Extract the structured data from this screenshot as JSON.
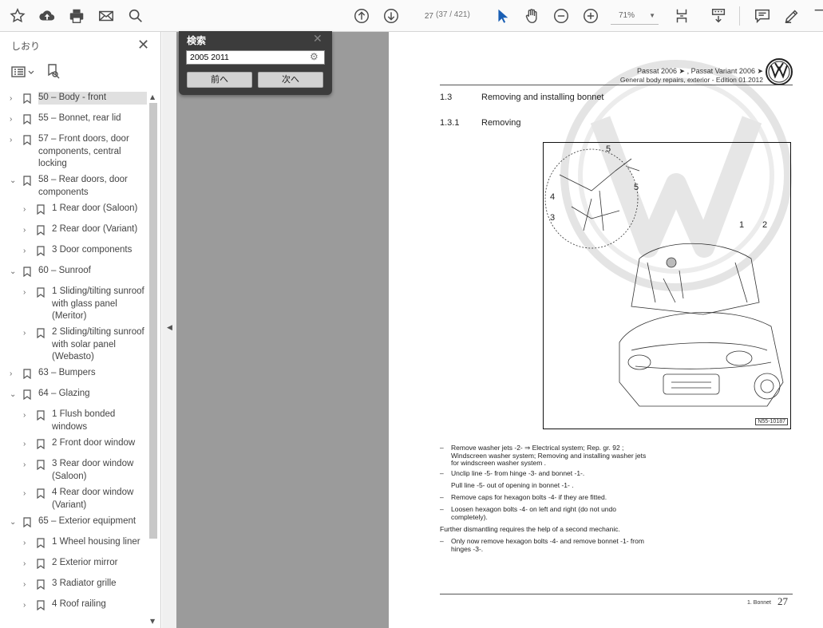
{
  "toolbar": {
    "page_current": "27",
    "page_count": "(37 / 421)",
    "zoom": "71%"
  },
  "sidebar": {
    "title": "しおり",
    "items": [
      {
        "label": "50 – Body - front",
        "level": 0,
        "chev": "›",
        "selected": true
      },
      {
        "label": "55 – Bonnet, rear lid",
        "level": 0,
        "chev": "›"
      },
      {
        "label": "57 – Front doors, door components, central locking",
        "level": 0,
        "chev": "›"
      },
      {
        "label": "58 – Rear doors, door components",
        "level": 0,
        "chev": "⌄"
      },
      {
        "label": "1 Rear door (Saloon)",
        "level": 1,
        "chev": "›"
      },
      {
        "label": "2 Rear door (Variant)",
        "level": 1,
        "chev": "›"
      },
      {
        "label": "3 Door components",
        "level": 1,
        "chev": "›"
      },
      {
        "label": "60 – Sunroof",
        "level": 0,
        "chev": "⌄"
      },
      {
        "label": "1 Sliding/tilting sunroof with glass panel (Meritor)",
        "level": 1,
        "chev": "›"
      },
      {
        "label": "2 Sliding/tilting sunroof with solar panel (Webasto)",
        "level": 1,
        "chev": "›"
      },
      {
        "label": "63 – Bumpers",
        "level": 0,
        "chev": "›"
      },
      {
        "label": "64 – Glazing",
        "level": 0,
        "chev": "⌄"
      },
      {
        "label": "1 Flush bonded windows",
        "level": 1,
        "chev": "›"
      },
      {
        "label": "2 Front door window",
        "level": 1,
        "chev": "›"
      },
      {
        "label": "3 Rear door window (Saloon)",
        "level": 1,
        "chev": "›"
      },
      {
        "label": "4 Rear door window (Variant)",
        "level": 1,
        "chev": "›"
      },
      {
        "label": "65 – Exterior equipment",
        "level": 0,
        "chev": "⌄"
      },
      {
        "label": "1 Wheel housing liner",
        "level": 1,
        "chev": "›"
      },
      {
        "label": "2 Exterior mirror",
        "level": 1,
        "chev": "›"
      },
      {
        "label": "3 Radiator grille",
        "level": 1,
        "chev": "›"
      },
      {
        "label": "4 Roof railing",
        "level": 1,
        "chev": "›"
      }
    ]
  },
  "search": {
    "title": "検索",
    "value": "2005 2011",
    "prev_label": "前へ",
    "next_label": "次へ"
  },
  "page": {
    "header_line1": "Passat 2006 ➤ , Passat Variant 2006 ➤",
    "header_line2": "General body repairs, exterior - Edition 01.2012",
    "section_num": "1.3",
    "section_title": "Removing and installing bonnet",
    "subsection_num": "1.3.1",
    "subsection_title": "Removing",
    "figure_labels": [
      "5",
      "4",
      "3",
      "5",
      "1",
      "2"
    ],
    "figure_id": "N55-10187",
    "steps": [
      {
        "dash": "–",
        "text": "Remove washer jets -2- ⇒ Electrical system; Rep. gr. 92 ; Windscreen washer system; Removing and installing washer jets for windscreen washer system ."
      },
      {
        "dash": "–",
        "text": "Unclip line -5- from hinge -3- and bonnet -1-."
      },
      {
        "dash": "",
        "text": "Pull line -5- out of opening in bonnet -1- ."
      },
      {
        "dash": "–",
        "text": "Remove caps for hexagon bolts -4- if they are fitted."
      },
      {
        "dash": "–",
        "text": "Loosen hexagon bolts -4- on left and right (do not undo completely)."
      },
      {
        "dash": "",
        "text": "Further dismantling requires the help of a second mechanic."
      },
      {
        "dash": "–",
        "text": "Only now remove hexagon bolts -4- and remove bonnet -1- from hinges -3-."
      }
    ],
    "footer_label": "1. Bonnet",
    "footer_page": "27"
  }
}
